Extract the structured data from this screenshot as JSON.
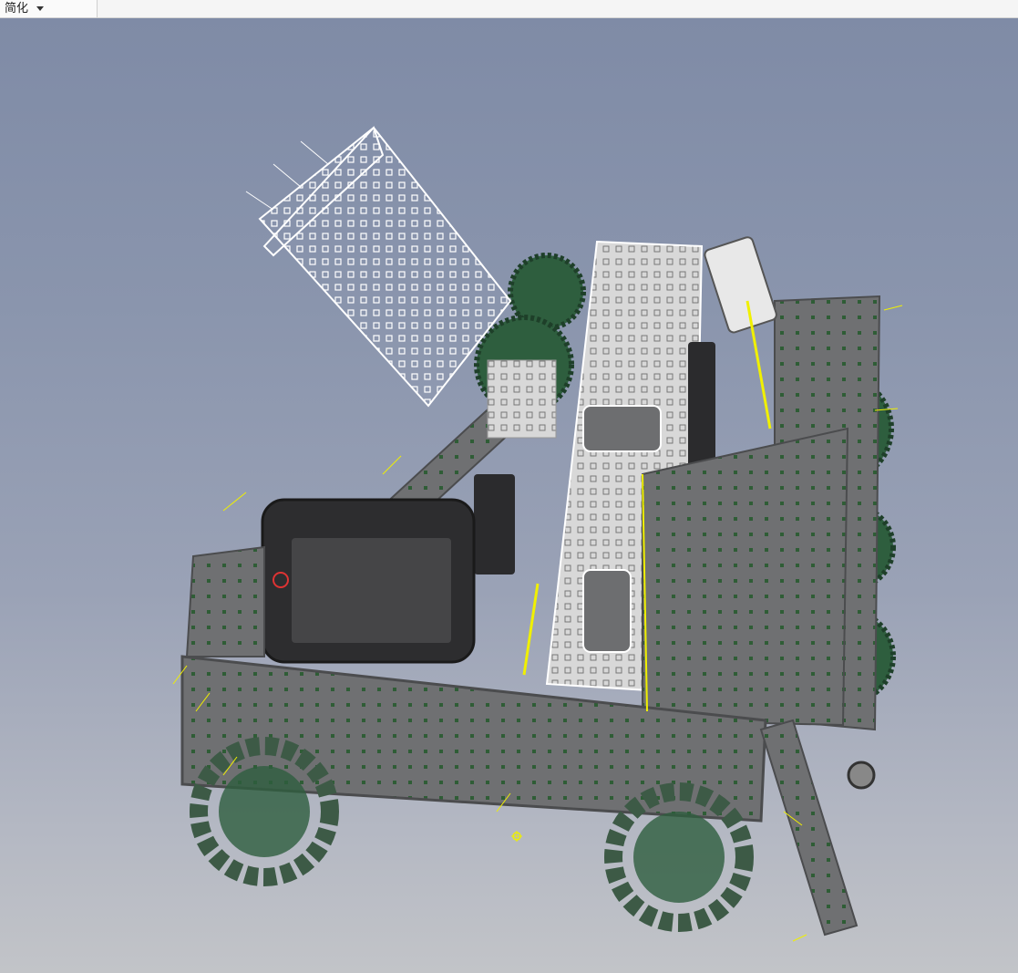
{
  "toolbar": {
    "mode_label": "简化",
    "mode_dropdown_icon": "caret-down-icon"
  },
  "viewport": {
    "model": "robot-assembly",
    "origin_marker_icon": "origin-marker-icon"
  },
  "colors": {
    "background_top": "#7f8ba6",
    "background_bottom": "#c2c4c8",
    "metal": "#6d6e70",
    "gear": "#2e5e3e",
    "wireframe": "#f2f2f2",
    "constraint": "#f0f000",
    "brain_screen": "#3a3a3c"
  }
}
